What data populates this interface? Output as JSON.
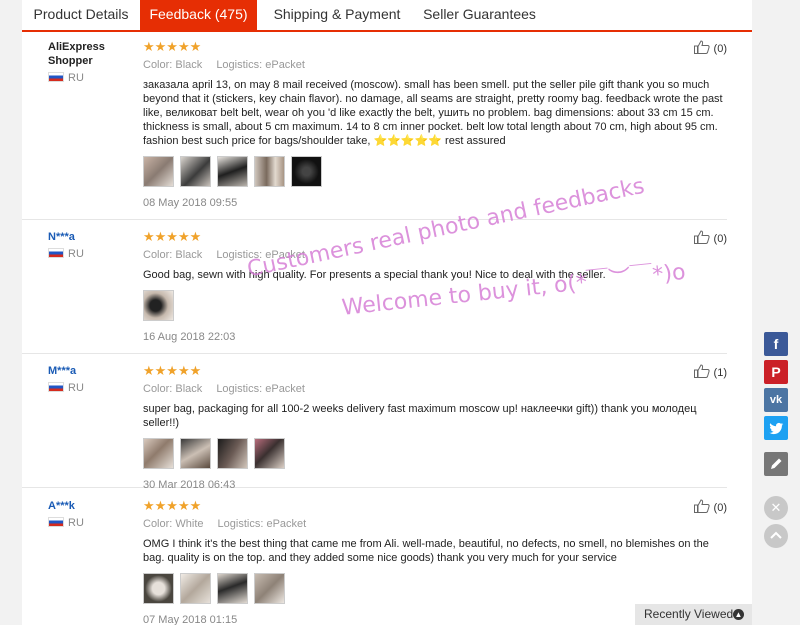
{
  "tabs": [
    {
      "label": "Product Details",
      "active": false
    },
    {
      "label": "Feedback (475)",
      "active": true
    },
    {
      "label": "Shipping & Payment",
      "active": false
    },
    {
      "label": "Seller Guarantees",
      "active": false
    }
  ],
  "labels": {
    "color": "Color:",
    "logistics": "Logistics:"
  },
  "reviews": [
    {
      "buyer": "AliExpress Shopper",
      "country": "RU",
      "stars": "★★★★★",
      "color": "Black",
      "logistics": "ePacket",
      "helpful": "(0)",
      "text": "заказала april 13, on may 8 mail received (moscow). small has been smell. put the seller pile gift thank you so much beyond that it (stickers, key chain flavor). no damage, all seams are straight, pretty roomy bag. feedback wrote the past like, великоват belt belt, wear oh you 'd like exactly the belt, ушить no problem. bag dimensions: about 33 cm 15 cm. thickness is small, about 5 cm maximum. 14 to 8 cm inner pocket. belt low total length about 70 cm, high about 95 cm. fashion best such price for bags/shoulder take, ⭐⭐⭐⭐⭐ rest assured",
      "photos": 5,
      "date": "08 May 2018 09:55"
    },
    {
      "buyer": "N***a",
      "country": "RU",
      "stars": "★★★★★",
      "color": "Black",
      "logistics": "ePacket",
      "helpful": "(0)",
      "text": "Good bag, sewn with high quality. For presents a special thank you! Nice to deal with the seller.",
      "photos": 1,
      "date": "16 Aug 2018 22:03"
    },
    {
      "buyer": "M***a",
      "country": "RU",
      "stars": "★★★★★",
      "color": "Black",
      "logistics": "ePacket",
      "helpful": "(1)",
      "text": "super bag, packaging for all 100-2 weeks delivery fast maximum moscow up! наклеечки gift)) thank you молодец seller!!)",
      "photos": 4,
      "date": "30 Mar 2018 06:43"
    },
    {
      "buyer": "A***k",
      "country": "RU",
      "stars": "★★★★★",
      "color": "White",
      "logistics": "ePacket",
      "helpful": "(0)",
      "text": "OMG I think it's the best thing that came me from Ali. well-made, beautiful, no defects, no smell, no blemishes on the bag. quality is on the top. and they added some nice goods) thank you very much for your service",
      "photos": 4,
      "date": "07 May 2018 01:15"
    }
  ],
  "watermark": {
    "line1": "Customers real photo and feedbacks",
    "line2": "Welcome to buy it, o(*￣︶￣*)o"
  },
  "sidebar": {
    "recently_viewed": "Recently Viewed"
  },
  "colors": {
    "accent": "#e62e04",
    "star": "#f0a22a"
  }
}
